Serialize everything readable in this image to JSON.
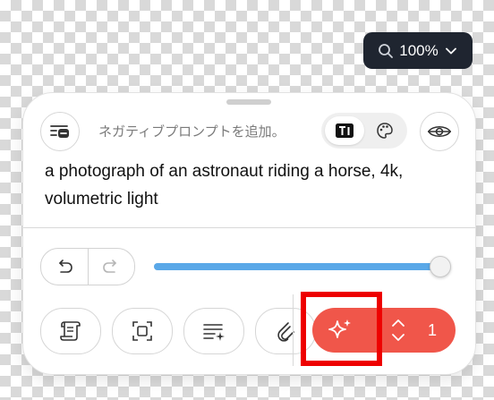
{
  "zoom": {
    "label": "100%",
    "icons": [
      "search-icon",
      "chevron-down-icon"
    ]
  },
  "prompt_panel": {
    "negative_prompt_placeholder": "ネガティブプロンプトを追加。",
    "prompt_text": "a photograph of an astronaut riding a horse, 4k, volumetric light",
    "mode_toggle": {
      "icons": [
        "text-image-icon",
        "palette-icon"
      ],
      "selected": "text-image-icon"
    },
    "eye_icon": "eye-icon"
  },
  "controls": {
    "undo_icon": "undo-icon",
    "redo_icon": "redo-icon",
    "slider_value": 0.99,
    "slider_color": "#5aa8e8"
  },
  "toolbar": {
    "tools": [
      "scroll-icon",
      "focus-frame-icon",
      "text-sparkle-icon",
      "paperclip-icon"
    ],
    "generate": {
      "icon": "sparkle-icon",
      "count": "1",
      "color": "#f0564a"
    }
  },
  "highlight": {
    "color": "#ee0000"
  }
}
